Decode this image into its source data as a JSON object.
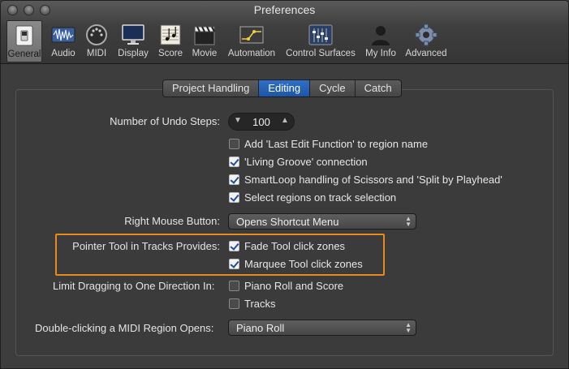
{
  "window": {
    "title": "Preferences"
  },
  "toolbar": [
    {
      "label": "General",
      "icon": "general-switch-icon",
      "active": true
    },
    {
      "label": "Audio",
      "icon": "audio-waveform-icon"
    },
    {
      "label": "MIDI",
      "icon": "midi-connector-icon"
    },
    {
      "label": "Display",
      "icon": "display-monitor-icon"
    },
    {
      "label": "Score",
      "icon": "score-notes-icon"
    },
    {
      "label": "Movie",
      "icon": "movie-clapper-icon"
    },
    {
      "label": "Automation",
      "icon": "automation-curve-icon"
    },
    {
      "label": "Control Surfaces",
      "icon": "control-surfaces-faders-icon"
    },
    {
      "label": "My Info",
      "icon": "my-info-person-icon"
    },
    {
      "label": "Advanced",
      "icon": "advanced-gear-icon"
    }
  ],
  "tabs": [
    {
      "label": "Project Handling"
    },
    {
      "label": "Editing",
      "selected": true
    },
    {
      "label": "Cycle"
    },
    {
      "label": "Catch"
    }
  ],
  "undo": {
    "label": "Number of Undo Steps:",
    "value": "100"
  },
  "options": [
    {
      "label": "Add 'Last Edit Function' to region name",
      "checked": false
    },
    {
      "label": "'Living Groove' connection",
      "checked": true
    },
    {
      "label": "SmartLoop handling of Scissors and 'Split by Playhead'",
      "checked": true
    },
    {
      "label": "Select regions on track selection",
      "checked": true
    }
  ],
  "right_mouse": {
    "label": "Right Mouse Button:",
    "value": "Opens Shortcut Menu"
  },
  "pointer_tool": {
    "label": "Pointer Tool in Tracks Provides:",
    "options": [
      {
        "label": "Fade Tool click zones",
        "checked": true
      },
      {
        "label": "Marquee Tool click zones",
        "checked": true
      }
    ],
    "highlight_color": "#e68a1a"
  },
  "limit_drag": {
    "label": "Limit Dragging to One Direction In:",
    "options": [
      {
        "label": "Piano Roll and Score",
        "checked": false
      },
      {
        "label": "Tracks",
        "checked": false
      }
    ]
  },
  "midi_region": {
    "label": "Double-clicking a MIDI Region Opens:",
    "value": "Piano Roll"
  },
  "colors": {
    "accent": "#1d56a8",
    "background": "#3d3d3d"
  }
}
